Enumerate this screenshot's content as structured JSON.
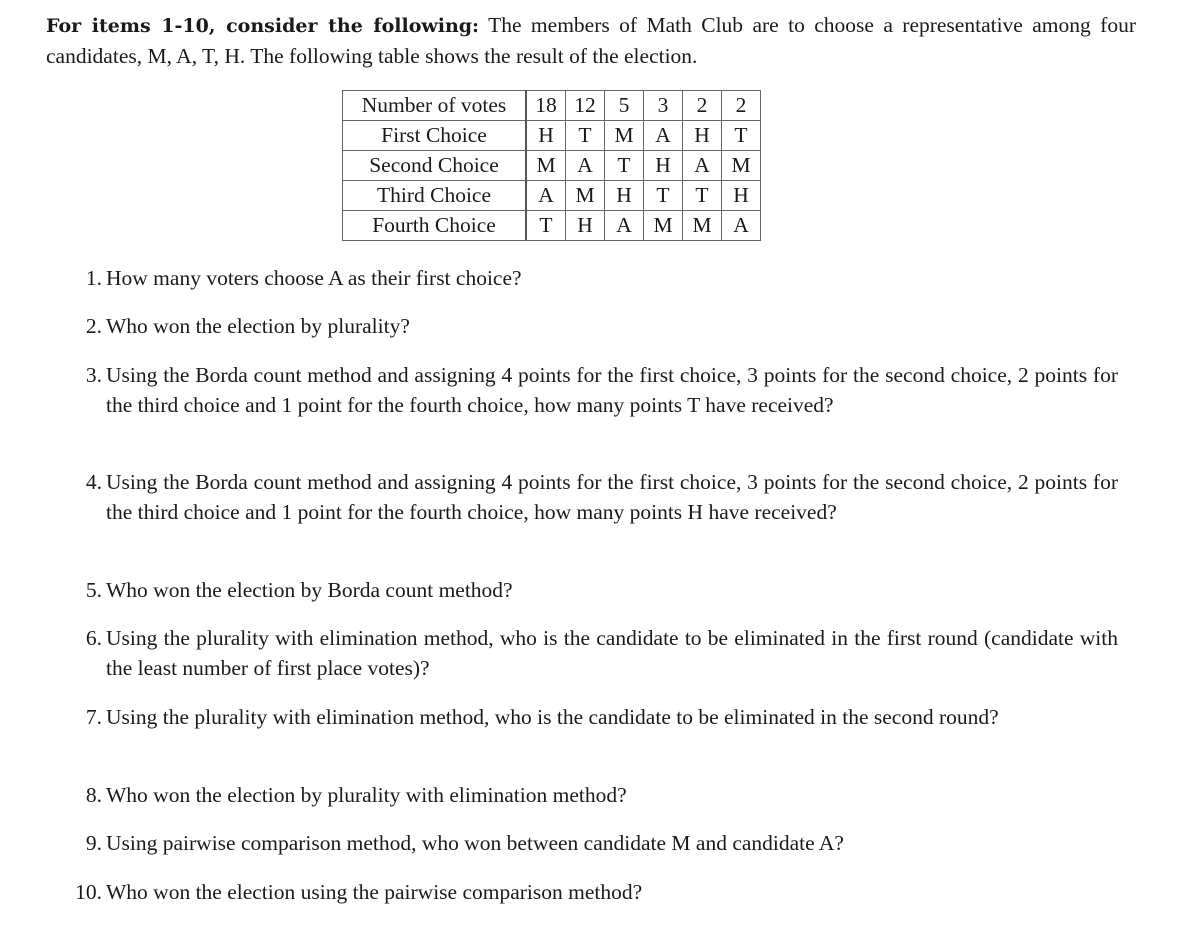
{
  "intro": {
    "bold_lead": "For items 1-10, consider the following:",
    "text": " The members of Math Club are to choose a representative among four candidates, M, A, T, H. The following table shows the result of the election."
  },
  "table": {
    "row_labels": [
      "Number of votes",
      "First Choice",
      "Second Choice",
      "Third Choice",
      "Fourth Choice"
    ],
    "votes": [
      "18",
      "12",
      "5",
      "3",
      "2",
      "2"
    ],
    "first": [
      "H",
      "T",
      "M",
      "A",
      "H",
      "T"
    ],
    "second": [
      "M",
      "A",
      "T",
      "H",
      "A",
      "M"
    ],
    "third": [
      "A",
      "M",
      "H",
      "T",
      "T",
      "H"
    ],
    "fourth": [
      "T",
      "H",
      "A",
      "M",
      "M",
      "A"
    ]
  },
  "questions": [
    {
      "num": "1.",
      "text": "How many voters choose A as their first choice?"
    },
    {
      "num": "2.",
      "text": "Who won the election by plurality?"
    },
    {
      "num": "3.",
      "text": "Using the Borda count method and assigning 4 points for the first choice, 3 points for the second choice, 2 points for the third choice and 1 point for the fourth choice, how many points T have received?"
    },
    {
      "num": "4.",
      "text": "Using the Borda count method and assigning 4 points for the first choice, 3 points for the second choice, 2 points for the third choice and 1 point for the fourth choice, how many points H have received?"
    },
    {
      "num": "5.",
      "text": "Who won the election by Borda count method?"
    },
    {
      "num": "6.",
      "text": "Using the plurality with elimination method, who is the candidate to be eliminated in the first round (candidate with the least number of first place votes)?"
    },
    {
      "num": "7.",
      "text": "Using the plurality with elimination method, who is the candidate to be eliminated in the second round?"
    },
    {
      "num": "8.",
      "text": "Who won the election by plurality with elimination method?"
    },
    {
      "num": "9.",
      "text": "Using pairwise comparison method, who won between candidate M and candidate A?"
    },
    {
      "num": "10.",
      "text": "Who won the election using the pairwise comparison method?"
    }
  ]
}
